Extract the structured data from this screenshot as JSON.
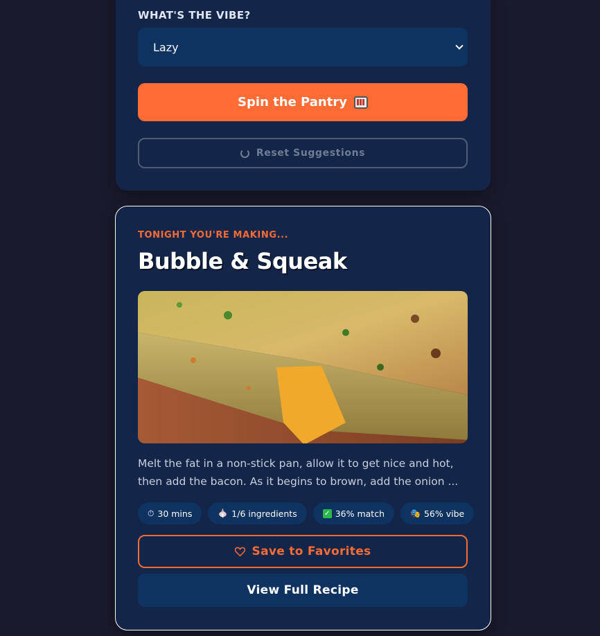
{
  "vibe": {
    "label": "WHAT'S THE VIBE?",
    "selected": "Lazy"
  },
  "actions": {
    "spin_label": "Spin the Pantry",
    "spin_icon": "slot-machine-icon",
    "reset_label": "Reset Suggestions",
    "reset_icon": "refresh-icon"
  },
  "result": {
    "eyebrow": "TONIGHT YOU'RE MAKING...",
    "title": "Bubble & Squeak",
    "description": "Melt the fat in a non-stick pan, allow it to get nice and hot, then add the bacon. As it begins to brown, add the onion ...",
    "chips": [
      {
        "icon": "stopwatch-icon",
        "glyph": "⏱",
        "text": "30 mins"
      },
      {
        "icon": "garlic-icon",
        "glyph": "🧄",
        "text": "1/6 ingredients"
      },
      {
        "icon": "check-icon",
        "glyph": "✓",
        "text": "36% match"
      },
      {
        "icon": "theater-masks-icon",
        "glyph": "🎭",
        "text": "56% vibe"
      }
    ],
    "save_label": "Save to Favorites",
    "save_icon": "heart-icon",
    "view_label": "View Full Recipe"
  },
  "colors": {
    "page_bg": "#1a1a2e",
    "card_bg": "#132548",
    "accent": "#ff6b35",
    "control_bg": "#0f3360"
  }
}
